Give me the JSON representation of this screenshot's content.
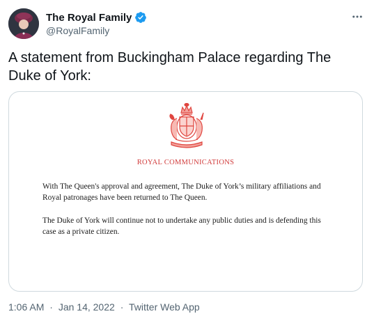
{
  "account": {
    "display_name": "The Royal Family",
    "handle": "@RoyalFamily",
    "verified_icon": "verified-badge-icon",
    "more_icon": "more-horizontal-icon"
  },
  "tweet": {
    "text": "A statement from Buckingham Palace regarding The Duke of York:"
  },
  "statement": {
    "letterhead": "ROYAL COMMUNICATIONS",
    "paragraph_1": "With The Queen's approval and agreement, The Duke of York’s military affiliations and Royal patronages have been returned to The Queen.",
    "paragraph_2": "The Duke of York will continue not to undertake any public duties and is defending this case as a private citizen."
  },
  "meta": {
    "time": "1:06 AM",
    "date": "Jan 14, 2022",
    "source": "Twitter Web App",
    "separator": "·"
  },
  "colors": {
    "verified": "#1d9bf0",
    "crest": "#e0453f",
    "secondary_text": "#536471",
    "border": "#cfd9de"
  }
}
